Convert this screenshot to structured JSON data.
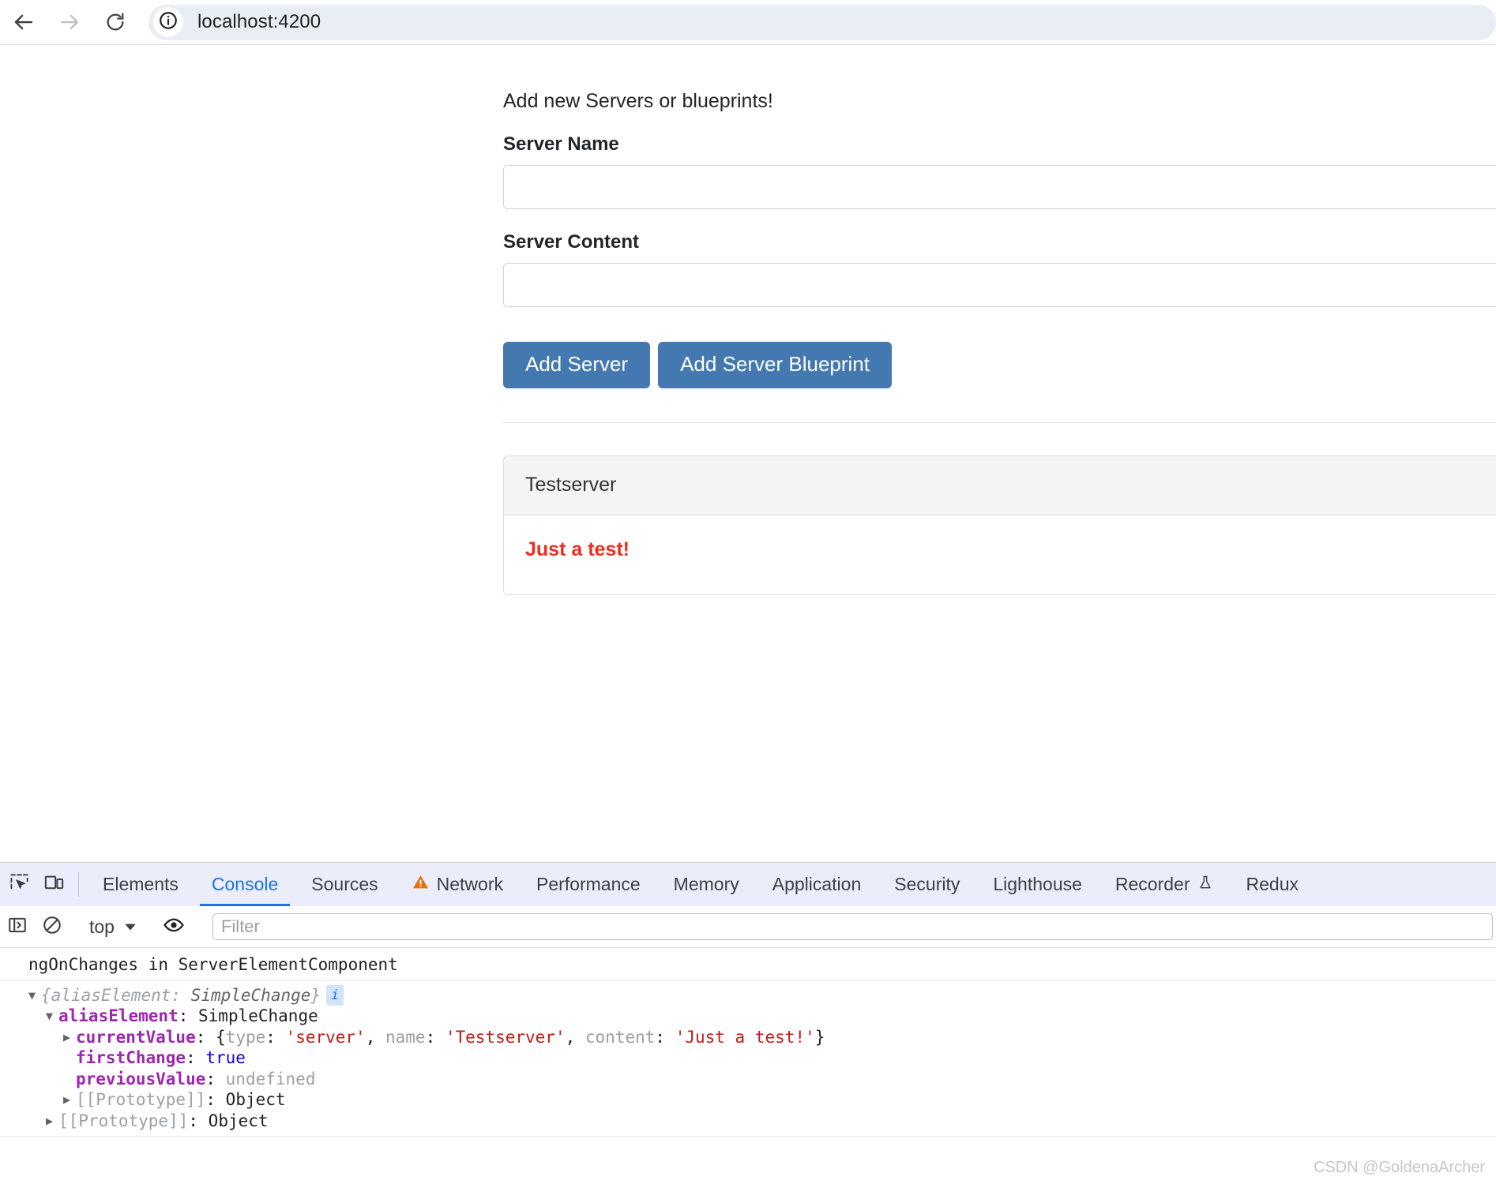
{
  "browser": {
    "url": "localhost:4200",
    "back_icon": "arrow-left-icon",
    "forward_icon": "arrow-right-icon",
    "reload_icon": "reload-icon",
    "site_info_icon": "info-circle-icon"
  },
  "app": {
    "heading": "Add new Servers or blueprints!",
    "server_name": {
      "label": "Server Name",
      "value": "",
      "placeholder": ""
    },
    "server_content": {
      "label": "Server Content",
      "value": "",
      "placeholder": ""
    },
    "buttons": {
      "add_server": "Add Server",
      "add_server_blueprint": "Add Server Blueprint"
    },
    "server_card": {
      "name": "Testserver",
      "content": "Just a test!",
      "content_color": "#ee2d20"
    },
    "accent_color": "#4478b0"
  },
  "devtools": {
    "tabs": [
      {
        "label": "Elements",
        "active": false,
        "icon": null
      },
      {
        "label": "Console",
        "active": true,
        "icon": null
      },
      {
        "label": "Sources",
        "active": false,
        "icon": null
      },
      {
        "label": "Network",
        "active": false,
        "icon": "warning-triangle-icon"
      },
      {
        "label": "Performance",
        "active": false,
        "icon": null
      },
      {
        "label": "Memory",
        "active": false,
        "icon": null
      },
      {
        "label": "Application",
        "active": false,
        "icon": null
      },
      {
        "label": "Security",
        "active": false,
        "icon": null
      },
      {
        "label": "Lighthouse",
        "active": false,
        "icon": null
      },
      {
        "label": "Recorder",
        "active": false,
        "icon": "flask-icon"
      },
      {
        "label": "Redux",
        "active": false,
        "icon": null
      }
    ],
    "inspect_icon": "inspect-element-icon",
    "device_toolbar_icon": "device-toolbar-icon",
    "filterbar": {
      "sidebar_icon": "console-sidebar-icon",
      "clear_icon": "clear-console-icon",
      "context": "top",
      "context_caret": "caret-down-icon",
      "eye_icon": "live-expression-eye-icon",
      "filter_placeholder": "Filter",
      "filter_value": ""
    },
    "console": {
      "message": "ngOnChanges in ServerElementComponent",
      "object": {
        "preview_open": "{",
        "preview_key": "aliasElement",
        "preview_sep": ": ",
        "preview_class": "SimpleChange",
        "preview_close": "}",
        "info_badge": "i",
        "rows": [
          {
            "key": "aliasElement",
            "sep": ": ",
            "value": "SimpleChange"
          },
          {
            "key": "currentValue",
            "sep": ": ",
            "brace_open": "{",
            "inner": [
              {
                "k": "type",
                "sep": ": ",
                "v": "'server'",
                "tail": ", "
              },
              {
                "k": "name",
                "sep": ": ",
                "v": "'Testserver'",
                "tail": ", "
              },
              {
                "k": "content",
                "sep": ": ",
                "v": "'Just a test!'",
                "tail": ""
              }
            ],
            "brace_close": "}"
          },
          {
            "key": "firstChange",
            "sep": ": ",
            "value": "true"
          },
          {
            "key": "previousValue",
            "sep": ": ",
            "value": "undefined"
          },
          {
            "key": "[[Prototype]]",
            "sep": ": ",
            "value": "Object"
          }
        ],
        "outer_prototype": {
          "key": "[[Prototype]]",
          "sep": ": ",
          "value": "Object"
        }
      }
    }
  },
  "watermark": "CSDN @GoldenaArcher"
}
